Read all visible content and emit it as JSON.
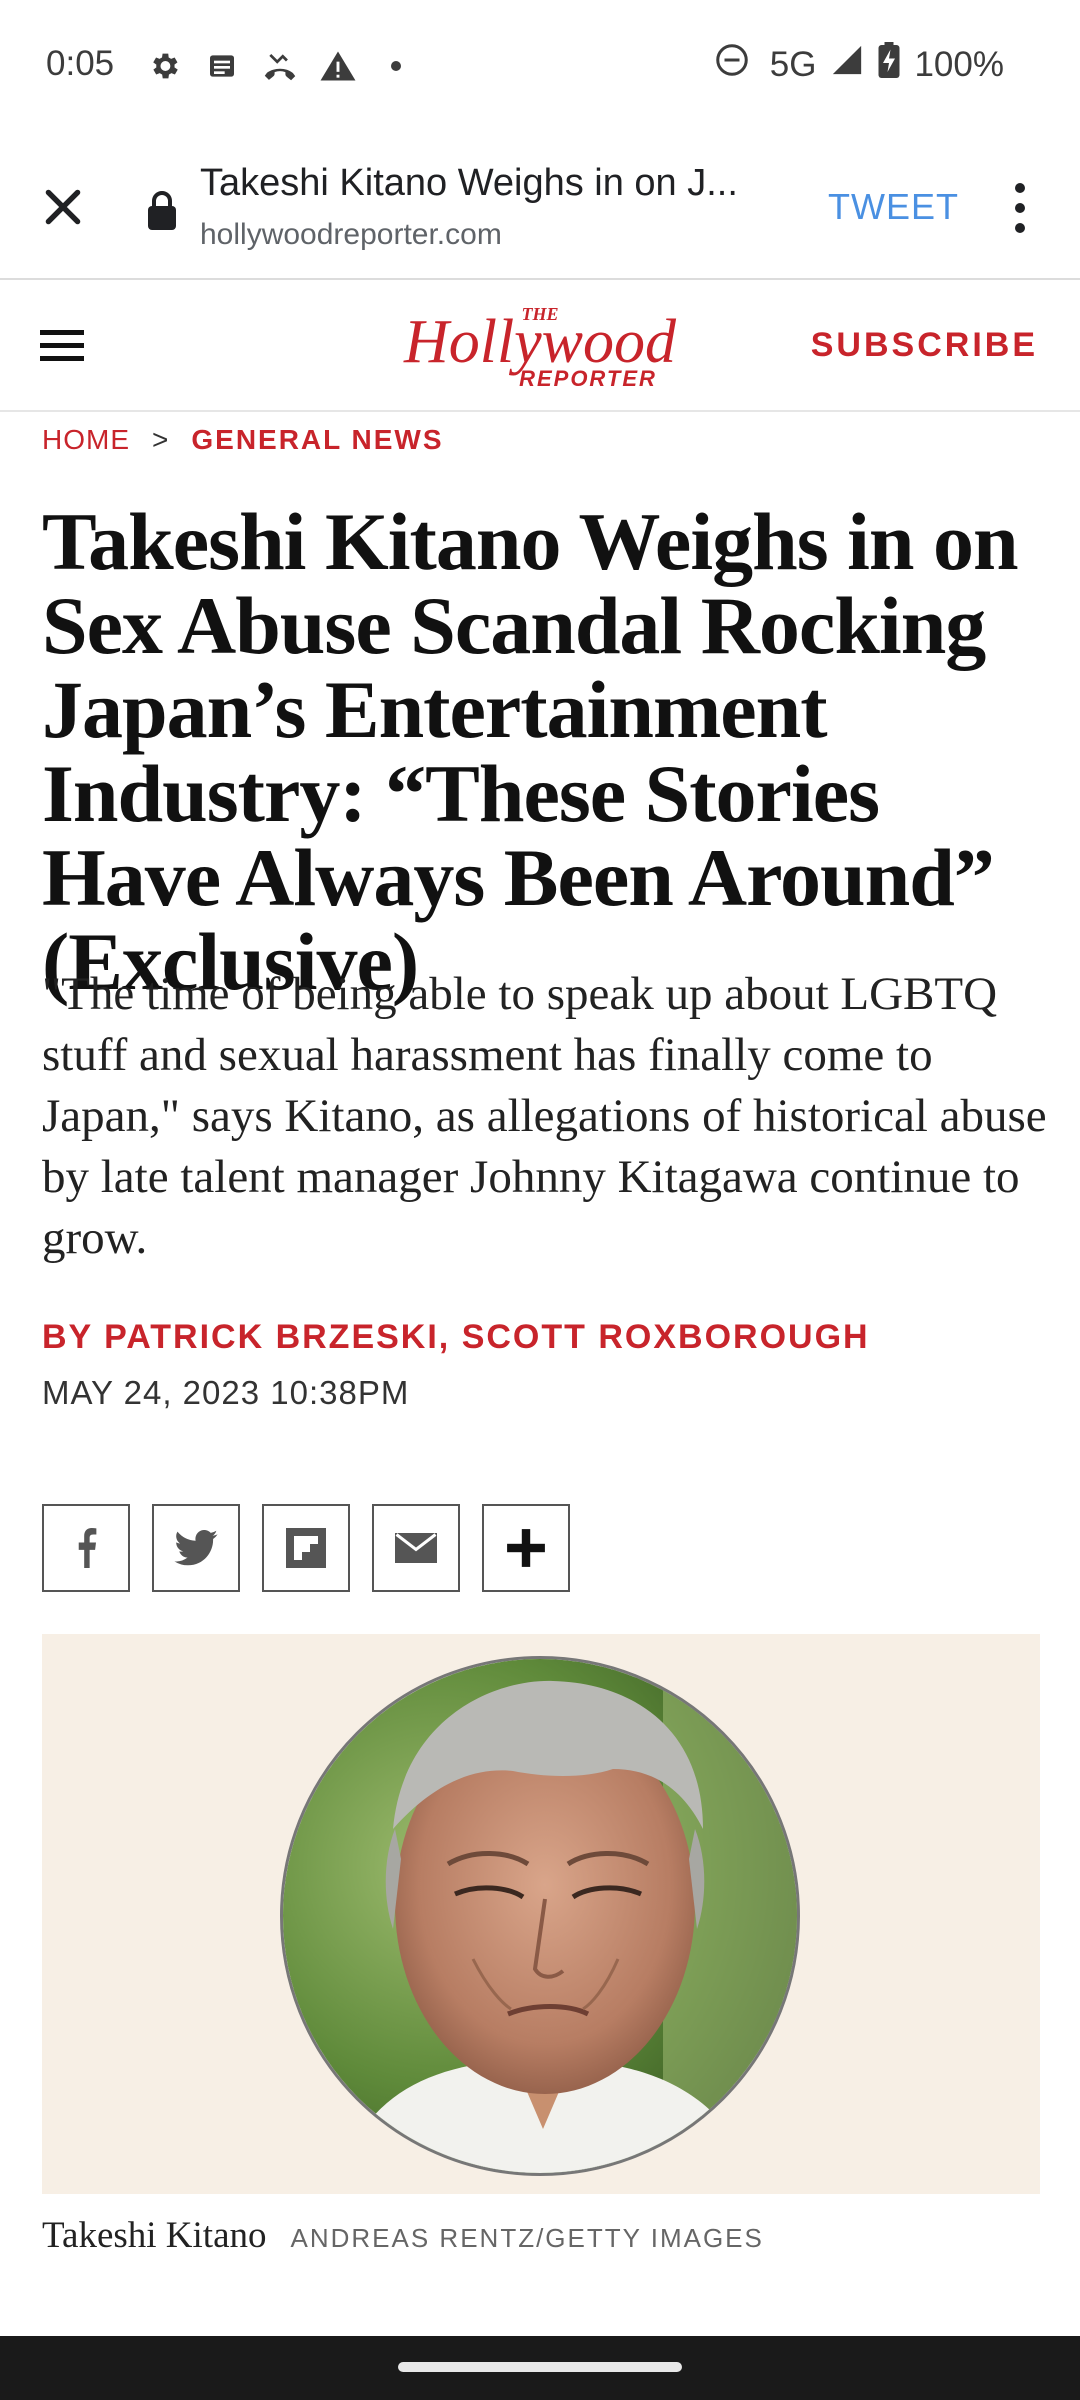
{
  "status": {
    "time": "0:05",
    "network": "5G",
    "battery": "100%",
    "icons": [
      "settings-icon",
      "news-icon",
      "missed-call-icon",
      "warning-icon",
      "dot-icon",
      "dnd-icon",
      "signal-icon",
      "battery-charging-icon"
    ]
  },
  "browser": {
    "title": "Takeshi Kitano Weighs in on J...",
    "url": "hollywoodreporter.com",
    "action_label": "TWEET"
  },
  "site": {
    "logo_the": "THE",
    "logo_main": "Hollywood",
    "logo_sub": "REPORTER",
    "subscribe_label": "SUBSCRIBE",
    "brand_color": "#c8242b"
  },
  "breadcrumb": {
    "home": "HOME",
    "separator": ">",
    "category": "GENERAL NEWS"
  },
  "article": {
    "headline": "Takeshi Kitano Weighs in on Sex Abuse Scandal Rocking Japan’s Entertainment Industry: “These Stories Have Always Been Around” (Exclusive)",
    "dek": "\"The time of being able to speak up about LGBTQ stuff and sexual harassment has finally come to Japan,\" says Kitano, as allegations of historical abuse by late talent manager Johnny Kitagawa continue to grow.",
    "byline": "BY PATRICK BRZESKI, SCOTT ROXBOROUGH",
    "date": "MAY 24, 2023 10:38PM"
  },
  "share": [
    "facebook-icon",
    "twitter-icon",
    "flipboard-icon",
    "email-icon",
    "plus-icon"
  ],
  "image": {
    "caption": "Takeshi Kitano",
    "credit": "ANDREAS RENTZ/GETTY IMAGES"
  }
}
